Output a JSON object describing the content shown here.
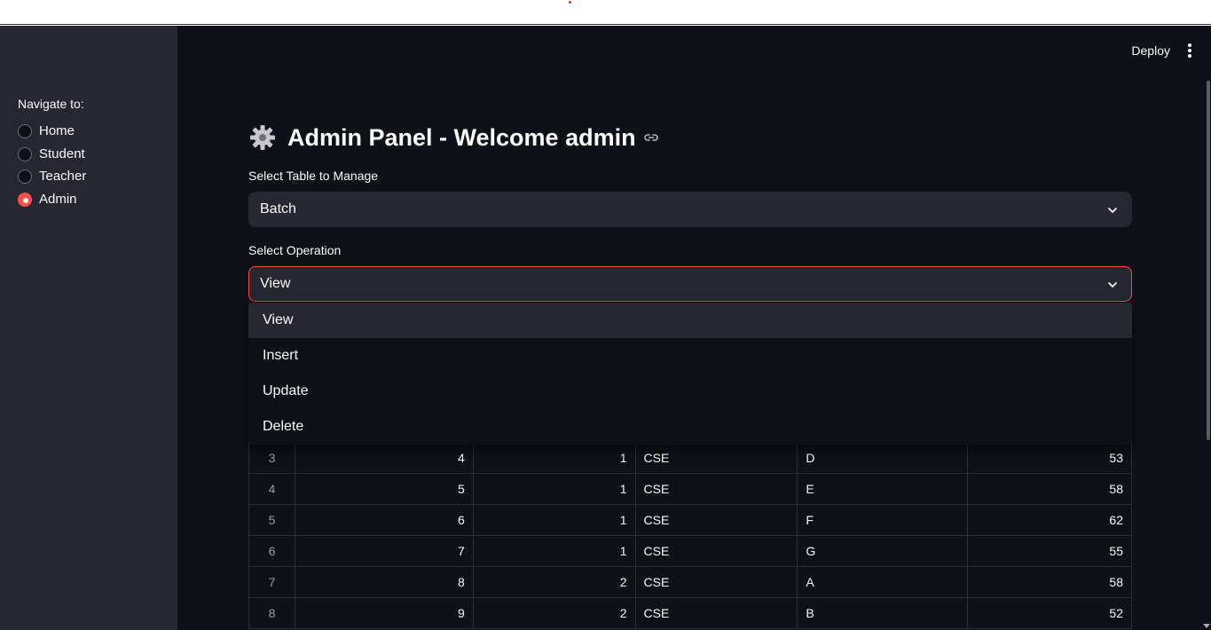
{
  "sidebar": {
    "nav_title": "Navigate to:",
    "options": [
      {
        "label": "Home",
        "selected": false
      },
      {
        "label": "Student",
        "selected": false
      },
      {
        "label": "Teacher",
        "selected": false
      },
      {
        "label": "Admin",
        "selected": true
      }
    ]
  },
  "header": {
    "deploy_label": "Deploy",
    "menu_icon": "kebab-menu-icon"
  },
  "page": {
    "title_icon": "gear-icon",
    "title": "Admin Panel - Welcome admin",
    "anchor_icon": "link-icon"
  },
  "table_select": {
    "label": "Select Table to Manage",
    "value": "Batch"
  },
  "operation_select": {
    "label": "Select Operation",
    "value": "View",
    "options": [
      "View",
      "Insert",
      "Update",
      "Delete"
    ],
    "highlighted": "View"
  },
  "table": {
    "rows": [
      {
        "idx": "3",
        "c1": "4",
        "c2": "1",
        "c3": "CSE",
        "c4": "D",
        "c5": "53"
      },
      {
        "idx": "4",
        "c1": "5",
        "c2": "1",
        "c3": "CSE",
        "c4": "E",
        "c5": "58"
      },
      {
        "idx": "5",
        "c1": "6",
        "c2": "1",
        "c3": "CSE",
        "c4": "F",
        "c5": "62"
      },
      {
        "idx": "6",
        "c1": "7",
        "c2": "1",
        "c3": "CSE",
        "c4": "G",
        "c5": "55"
      },
      {
        "idx": "7",
        "c1": "8",
        "c2": "2",
        "c3": "CSE",
        "c4": "A",
        "c5": "58"
      },
      {
        "idx": "8",
        "c1": "9",
        "c2": "2",
        "c3": "CSE",
        "c4": "B",
        "c5": "52"
      }
    ]
  },
  "colors": {
    "accent": "#ff4b4b",
    "background": "#0e1117",
    "sidebar": "#262730",
    "text": "#fafafa"
  }
}
